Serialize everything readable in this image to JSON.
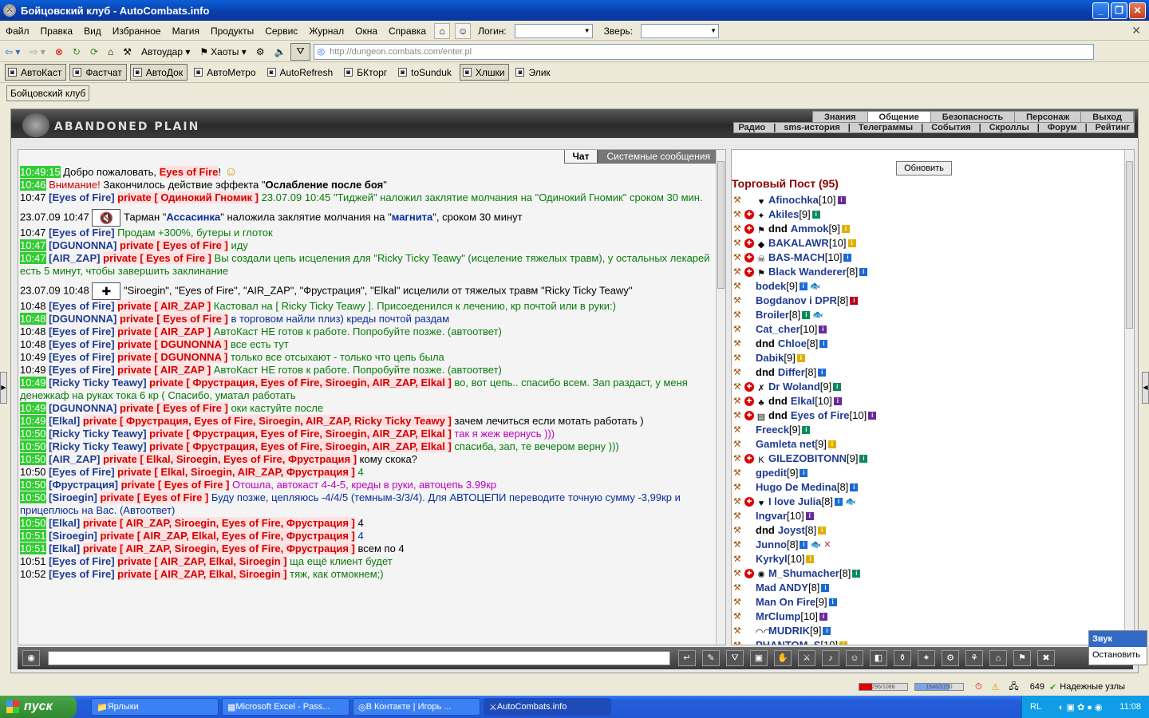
{
  "window": {
    "title": "Бойцовский клуб - AutoCombats.info"
  },
  "menu": [
    "Файл",
    "Правка",
    "Вид",
    "Избранное",
    "Магия",
    "Продукты",
    "Сервис",
    "Журнал",
    "Окна",
    "Справка"
  ],
  "login_label": "Логин:",
  "beast_label": "Зверь:",
  "toolbar": {
    "autoudar": "Автоудар",
    "haoty": "Хаоты",
    "url": "http://dungeon.combats.com/enter.pl"
  },
  "quick": [
    {
      "label": "АвтоКаст",
      "on": true
    },
    {
      "label": "Фастчат",
      "on": true
    },
    {
      "label": "АвтоДок",
      "on": true
    },
    {
      "label": "АвтоМетро",
      "on": false
    },
    {
      "label": "AutoRefresh",
      "on": false
    },
    {
      "label": "БКторг",
      "on": false
    },
    {
      "label": "toSunduk",
      "on": false
    },
    {
      "label": "Хлшки",
      "on": true
    },
    {
      "label": "Элик",
      "on": false
    }
  ],
  "doc_tab": "Бойцовский клуб",
  "banner": {
    "location": "ABANDONED PLAIN"
  },
  "nav1": [
    "Знания",
    "Общение",
    "Безопасность",
    "Персонаж",
    "Выход"
  ],
  "nav2": [
    "Радио",
    "|",
    "sms-история",
    "|",
    "Телеграммы",
    "|",
    "События",
    "|",
    "Скроллы",
    "|",
    "Форум",
    "|",
    "Рейтинг"
  ],
  "chat_tabs": {
    "chat": "Чат",
    "system": "Системные сообщения"
  },
  "refresh_label": "Обновить",
  "room_title": "Торговый Пост (95)",
  "users": [
    {
      "name": "Afinochka",
      "lvl": "[10]",
      "ex": false,
      "av": "♥",
      "inf": "p",
      "dnd": false
    },
    {
      "name": "Akiles",
      "lvl": "[9]",
      "ex": true,
      "av": "✦",
      "inf": "g",
      "dnd": false
    },
    {
      "name": "Ammok",
      "lvl": "[9]",
      "ex": true,
      "av": "⚑",
      "inf": "y",
      "dnd": true
    },
    {
      "name": "BAKALAWR",
      "lvl": "[10]",
      "ex": true,
      "av": "◆",
      "inf": "y",
      "dnd": false
    },
    {
      "name": "BAS-MACH",
      "lvl": "[10]",
      "ex": true,
      "av": "☠",
      "inf": "b",
      "dnd": false
    },
    {
      "name": "Black Wanderer",
      "lvl": "[8]",
      "ex": true,
      "av": "⚑",
      "inf": "b",
      "dnd": false
    },
    {
      "name": "bodek",
      "lvl": "[9]",
      "ex": false,
      "av": "",
      "inf": "b",
      "dnd": false,
      "extra": "🐟"
    },
    {
      "name": "Bogdanov i DPR",
      "lvl": "[8]",
      "ex": false,
      "av": "",
      "inf": "r",
      "dnd": false
    },
    {
      "name": "Broiler",
      "lvl": "[8]",
      "ex": false,
      "av": "",
      "inf": "g",
      "dnd": false,
      "extra": "🐟"
    },
    {
      "name": "Cat_cher",
      "lvl": "[10]",
      "ex": false,
      "av": "",
      "inf": "p",
      "dnd": false
    },
    {
      "name": "Chloe",
      "lvl": "[8]",
      "ex": false,
      "av": "",
      "inf": "b",
      "dnd": true
    },
    {
      "name": "Dabik",
      "lvl": "[9]",
      "ex": false,
      "av": "",
      "inf": "y",
      "dnd": false
    },
    {
      "name": "Differ",
      "lvl": "[8]",
      "ex": false,
      "av": "",
      "inf": "b",
      "dnd": true
    },
    {
      "name": "Dr Woland",
      "lvl": "[9]",
      "ex": true,
      "av": "✗",
      "inf": "g",
      "dnd": false
    },
    {
      "name": "Elkal",
      "lvl": "[10]",
      "ex": true,
      "av": "♣",
      "inf": "p",
      "dnd": true
    },
    {
      "name": "Eyes of Fire",
      "lvl": "[10]",
      "ex": true,
      "av": "▤",
      "inf": "p",
      "dnd": true
    },
    {
      "name": "Freeck",
      "lvl": "[9]",
      "ex": false,
      "av": "",
      "inf": "g",
      "dnd": false
    },
    {
      "name": "Gamleta net",
      "lvl": "[9]",
      "ex": false,
      "av": "",
      "inf": "y",
      "dnd": false
    },
    {
      "name": "GILEZOBITONN",
      "lvl": "[9]",
      "ex": true,
      "av": "K",
      "inf": "g",
      "dnd": false
    },
    {
      "name": "gpedit",
      "lvl": "[9]",
      "ex": false,
      "av": "",
      "inf": "b",
      "dnd": false
    },
    {
      "name": "Hugo De Medina",
      "lvl": "[8]",
      "ex": false,
      "av": "",
      "inf": "b",
      "dnd": false
    },
    {
      "name": "I love Julia",
      "lvl": "[8]",
      "ex": true,
      "av": "♥",
      "inf": "b",
      "dnd": false,
      "extra": "🐟"
    },
    {
      "name": "Ingvar",
      "lvl": "[10]",
      "ex": false,
      "av": "",
      "inf": "p",
      "dnd": false
    },
    {
      "name": "Joyst",
      "lvl": "[8]",
      "ex": false,
      "av": "",
      "inf": "y",
      "dnd": true
    },
    {
      "name": "Junno",
      "lvl": "[8]",
      "ex": false,
      "av": "",
      "inf": "b",
      "dnd": false,
      "extra": "🐟 ✕"
    },
    {
      "name": "Kyrkyl",
      "lvl": "[10]",
      "ex": false,
      "av": "",
      "inf": "y",
      "dnd": false
    },
    {
      "name": "M_Shumacher",
      "lvl": "[8]",
      "ex": true,
      "av": "✺",
      "inf": "g",
      "dnd": false
    },
    {
      "name": "Mad ANDY",
      "lvl": "[8]",
      "ex": false,
      "av": "",
      "inf": "b",
      "dnd": false
    },
    {
      "name": "Man On Fire",
      "lvl": "[9]",
      "ex": false,
      "av": "",
      "inf": "b",
      "dnd": false
    },
    {
      "name": "MrClump",
      "lvl": "[10]",
      "ex": false,
      "av": "",
      "inf": "p",
      "dnd": false
    },
    {
      "name": "MUDRIK",
      "lvl": "[9]",
      "ex": false,
      "av": "◠◠",
      "inf": "b",
      "dnd": false
    },
    {
      "name": "PHANTOM_S",
      "lvl": "[10]",
      "ex": false,
      "av": "",
      "inf": "y",
      "dnd": false
    }
  ],
  "chat": [
    {
      "t": "10:49:15",
      "hl": true,
      "parts": [
        [
          "",
          "Добро пожаловать, "
        ],
        [
          "priv",
          "Eyes of Fire"
        ],
        [
          "",
          "!"
        ]
      ],
      "emo": "☺"
    },
    {
      "t": "10:46",
      "hl": true,
      "parts": [
        [
          "sys",
          "Внимание! "
        ],
        [
          "",
          "Закончилось действие эффекта \""
        ],
        [
          "b",
          "Ослабление после боя"
        ],
        [
          "",
          "\""
        ]
      ]
    },
    {
      "t": "10:47",
      "hl": false,
      "parts": [
        [
          "nick",
          "[Eyes of Fire]"
        ],
        [
          "",
          "  "
        ],
        [
          "priv",
          "private [ Одинокий Гномик ]"
        ],
        [
          "grn",
          " 23.07.09 10:45 \"Тиджей\" наложил заклятие молчания на \"Одинокий Гномик\" сроком 30 мин."
        ]
      ]
    },
    {
      "t": "23.07.09 10:47",
      "hl": false,
      "big": true,
      "emo": "🔇",
      "parts": [
        [
          "",
          "Тарман \""
        ],
        [
          "blue",
          "Ассасинка"
        ],
        [
          "",
          "\" наложила заклятие молчания на \""
        ],
        [
          "blue",
          "магнита"
        ],
        [
          "",
          "\", сроком 30 минут"
        ]
      ]
    },
    {
      "t": "10:47",
      "hl": false,
      "parts": [
        [
          "nick",
          "[Eyes of Fire]"
        ],
        [
          "grn",
          " Продам +300%, бутеры и глоток"
        ]
      ]
    },
    {
      "t": "10:47",
      "hl": true,
      "parts": [
        [
          "nick",
          "[DGUNONNA]"
        ],
        [
          "",
          "  "
        ],
        [
          "priv",
          "private [ Eyes of Fire ]"
        ],
        [
          "grn",
          " иду"
        ]
      ]
    },
    {
      "t": "10:47",
      "hl": true,
      "parts": [
        [
          "nick",
          "[AIR_ZAP]"
        ],
        [
          "",
          "  "
        ],
        [
          "priv",
          "private [ Eyes of Fire ]"
        ],
        [
          "grn",
          " Вы создали цепь исцеления для \"Ricky Ticky Teawy\" (исцеление тяжелых травм), у остальных лекарей есть 5 минут, чтобы завершить заклинание"
        ]
      ]
    },
    {
      "t": "23.07.09 10:48",
      "hl": false,
      "big": true,
      "emo": "✚",
      "parts": [
        [
          "",
          "\"Siroegin\", \"Eyes of Fire\", \"AIR_ZAP\", \"Фрустрация\", \"Elkal\" исцелили от тяжелых травм \"Ricky Ticky Teawy\""
        ]
      ]
    },
    {
      "t": "10:48",
      "hl": false,
      "parts": [
        [
          "nick",
          "[Eyes of Fire]"
        ],
        [
          "",
          "  "
        ],
        [
          "priv",
          "private [ AIR_ZAP ]"
        ],
        [
          "grn",
          " Кастовал на [ Ricky Ticky Teawy ]. Присоеденился к лечению, кр почтой или в руки:)"
        ]
      ]
    },
    {
      "t": "10:48",
      "hl": true,
      "parts": [
        [
          "nick",
          "[DGUNONNA]"
        ],
        [
          "",
          "  "
        ],
        [
          "priv",
          "private [ Eyes of Fire ]"
        ],
        [
          "bl",
          " в торговом найли плиз) креды почтой раздам"
        ]
      ]
    },
    {
      "t": "10:48",
      "hl": false,
      "parts": [
        [
          "nick",
          "[Eyes of Fire]"
        ],
        [
          "",
          "  "
        ],
        [
          "priv",
          "private [ AIR_ZAP ]"
        ],
        [
          "grn",
          " АвтоКаст НЕ готов к работе. Попробуйте позже. (автоответ)"
        ]
      ]
    },
    {
      "t": "10:48",
      "hl": false,
      "parts": [
        [
          "nick",
          "[Eyes of Fire]"
        ],
        [
          "",
          "  "
        ],
        [
          "priv",
          "private [ DGUNONNA ]"
        ],
        [
          "grn",
          " все есть тут"
        ]
      ]
    },
    {
      "t": "10:49",
      "hl": false,
      "parts": [
        [
          "nick",
          "[Eyes of Fire]"
        ],
        [
          "",
          "  "
        ],
        [
          "priv",
          "private [ DGUNONNA ]"
        ],
        [
          "grn",
          " только все отсыхают - только что цепь была"
        ]
      ]
    },
    {
      "t": "10:49",
      "hl": false,
      "parts": [
        [
          "nick",
          "[Eyes of Fire]"
        ],
        [
          "",
          "  "
        ],
        [
          "priv",
          "private [ AIR_ZAP ]"
        ],
        [
          "grn",
          " АвтоКаст НЕ готов к работе. Попробуйте позже. (автоответ)"
        ]
      ]
    },
    {
      "t": "10:49",
      "hl": true,
      "parts": [
        [
          "nick",
          "[Ricky Ticky Teawy]"
        ],
        [
          "",
          "  "
        ],
        [
          "priv",
          "private [ Фрустрация, Eyes of Fire, Siroegin, AIR_ZAP, Elkal ]"
        ],
        [
          "grn",
          " во, вот цепь.. спасибо всем. Зап раздаст, у меня денежкаф на руках тока 6 кр ( Спасибо, уматал работать"
        ]
      ]
    },
    {
      "t": "10:49",
      "hl": true,
      "parts": [
        [
          "nick",
          "[DGUNONNA]"
        ],
        [
          "",
          "  "
        ],
        [
          "priv",
          "private [ Eyes of Fire ]"
        ],
        [
          "grn",
          " оки кастуйте после"
        ]
      ]
    },
    {
      "t": "10:49",
      "hl": true,
      "parts": [
        [
          "nick",
          "[Elkal]"
        ],
        [
          "",
          "  "
        ],
        [
          "priv",
          "private [ Фрустрация, Eyes of Fire, Siroegin, AIR_ZAP, Ricky Ticky Teawy ]"
        ],
        [
          "",
          ""
        ],
        [
          "k",
          " зачем лечиться если мотать работать )"
        ]
      ]
    },
    {
      "t": "10:50",
      "hl": true,
      "parts": [
        [
          "nick",
          "[Ricky Ticky Teawy]"
        ],
        [
          "",
          "  "
        ],
        [
          "priv",
          "private [ Фрустрация, Eyes of Fire, Siroegin, AIR_ZAP, Elkal ]"
        ],
        [
          "mag",
          " так я жеж вернусь )))"
        ]
      ]
    },
    {
      "t": "10:50",
      "hl": true,
      "parts": [
        [
          "nick",
          "[Ricky Ticky Teawy]"
        ],
        [
          "",
          "  "
        ],
        [
          "priv",
          "private [ Фрустрация, Eyes of Fire, Siroegin, AIR_ZAP, Elkal ]"
        ],
        [
          "grn",
          " спасиба, зап, те вечером верну )))"
        ]
      ]
    },
    {
      "t": "10:50",
      "hl": true,
      "parts": [
        [
          "nick",
          "[AIR_ZAP]"
        ],
        [
          "",
          "  "
        ],
        [
          "priv",
          "private [ Elkal, Siroegin, Eyes of Fire, Фрустрация ]"
        ],
        [
          "k",
          " кому скока?"
        ]
      ]
    },
    {
      "t": "10:50",
      "hl": false,
      "parts": [
        [
          "nick",
          "[Eyes of Fire]"
        ],
        [
          "",
          "  "
        ],
        [
          "priv",
          "private [ Elkal, Siroegin, AIR_ZAP, Фрустрация ]"
        ],
        [
          "grn",
          " 4"
        ]
      ]
    },
    {
      "t": "10:50",
      "hl": true,
      "parts": [
        [
          "nick",
          "[Фрустрация]"
        ],
        [
          "",
          "  "
        ],
        [
          "priv",
          "private [ Eyes of Fire ]"
        ],
        [
          "mag",
          " Отошла, автокаст 4-4-5, креды в руки, автоцепь 3.99кр"
        ]
      ]
    },
    {
      "t": "10:50",
      "hl": true,
      "parts": [
        [
          "nick",
          "[Siroegin]"
        ],
        [
          "",
          "  "
        ],
        [
          "priv",
          "private [ Eyes of Fire ]"
        ],
        [
          "bl",
          " Буду позже, цепляюсь -4/4/5 (темным-3/3/4). Для АВТОЦЕПИ переводите точную сумму -3,99кр и прицеплюсь на Вас. (Автоответ)"
        ]
      ]
    },
    {
      "t": "10:50",
      "hl": true,
      "parts": [
        [
          "nick",
          "[Elkal]"
        ],
        [
          "",
          "  "
        ],
        [
          "priv",
          "private [ AIR_ZAP, Siroegin, Eyes of Fire, Фрустрация ]"
        ],
        [
          "k",
          " 4"
        ]
      ]
    },
    {
      "t": "10:51",
      "hl": true,
      "parts": [
        [
          "nick",
          "[Siroegin]"
        ],
        [
          "",
          "  "
        ],
        [
          "priv",
          "private [ AIR_ZAP, Elkal, Eyes of Fire, Фрустрация ]"
        ],
        [
          "bl",
          " 4"
        ]
      ]
    },
    {
      "t": "10:51",
      "hl": true,
      "parts": [
        [
          "nick",
          "[Elkal]"
        ],
        [
          "",
          "  "
        ],
        [
          "priv",
          "private [ AIR_ZAP, Siroegin, Eyes of Fire, Фрустрация ]"
        ],
        [
          "k",
          " всем по 4"
        ]
      ]
    },
    {
      "t": "10:51",
      "hl": false,
      "parts": [
        [
          "nick",
          "[Eyes of Fire]"
        ],
        [
          "",
          "  "
        ],
        [
          "priv",
          "private [ AIR_ZAP, Elkal, Siroegin ]"
        ],
        [
          "grn",
          " ща ещё клиент будет"
        ]
      ]
    },
    {
      "t": "10:52",
      "hl": false,
      "parts": [
        [
          "nick",
          "[Eyes of Fire]"
        ],
        [
          "",
          "  "
        ],
        [
          "priv",
          "private [ AIR_ZAP, Elkal, Siroegin ]"
        ],
        [
          "grn",
          " тяж, как отмокнем;)"
        ]
      ]
    }
  ],
  "popup": {
    "sound": "Звук",
    "stop": "Остановить"
  },
  "status": {
    "hp": "296/1088",
    "mana": "1546/2150",
    "hp_frac": 0.27,
    "mana_frac": 0.72,
    "count": "649",
    "nodes": "Надежные узлы"
  },
  "taskbar": {
    "start": "пуск",
    "tasks": [
      "Ярлыки",
      "Microsoft Excel - Pass...",
      "В Контакте | Игорь ...",
      "AutoCombats.info"
    ],
    "lang": "RL",
    "time": "11:08"
  }
}
